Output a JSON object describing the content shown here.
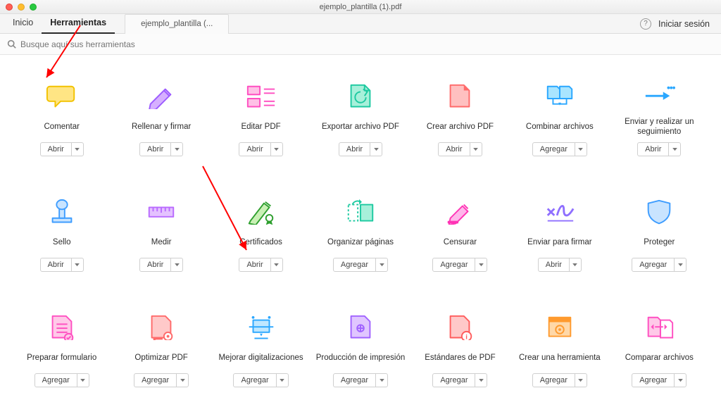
{
  "window": {
    "title": "ejemplo_plantilla (1).pdf"
  },
  "tabs": {
    "home": "Inicio",
    "tools": "Herramientas",
    "doc": "ejemplo_plantilla (..."
  },
  "header": {
    "signin": "Iniciar sesión"
  },
  "search": {
    "placeholder": "Busque aquí sus herramientas"
  },
  "actions": {
    "open": "Abrir",
    "add": "Agregar"
  },
  "tools": [
    {
      "id": "comentar",
      "label": "Comentar",
      "action": "open"
    },
    {
      "id": "rellenar",
      "label": "Rellenar y firmar",
      "action": "open"
    },
    {
      "id": "editar",
      "label": "Editar PDF",
      "action": "open"
    },
    {
      "id": "exportar",
      "label": "Exportar archivo PDF",
      "action": "open"
    },
    {
      "id": "crear",
      "label": "Crear archivo PDF",
      "action": "open"
    },
    {
      "id": "combinar",
      "label": "Combinar archivos",
      "action": "add"
    },
    {
      "id": "enviar-seg",
      "label": "Enviar y realizar un seguimiento",
      "action": "open"
    },
    {
      "id": "sello",
      "label": "Sello",
      "action": "open"
    },
    {
      "id": "medir",
      "label": "Medir",
      "action": "open"
    },
    {
      "id": "certificados",
      "label": "Certificados",
      "action": "open"
    },
    {
      "id": "organizar",
      "label": "Organizar páginas",
      "action": "add"
    },
    {
      "id": "censurar",
      "label": "Censurar",
      "action": "add"
    },
    {
      "id": "enviar-firmar",
      "label": "Enviar para firmar",
      "action": "open"
    },
    {
      "id": "proteger",
      "label": "Proteger",
      "action": "add"
    },
    {
      "id": "preparar-form",
      "label": "Preparar formulario",
      "action": "add"
    },
    {
      "id": "optimizar",
      "label": "Optimizar PDF",
      "action": "add"
    },
    {
      "id": "mejorar-dig",
      "label": "Mejorar digitalizaciones",
      "action": "add"
    },
    {
      "id": "produccion",
      "label": "Producción de impresión",
      "action": "add"
    },
    {
      "id": "estandares",
      "label": "Estándares de PDF",
      "action": "add"
    },
    {
      "id": "crear-herr",
      "label": "Crear una herramienta",
      "action": "add"
    },
    {
      "id": "comparar",
      "label": "Comparar archivos",
      "action": "add"
    }
  ],
  "icons": {
    "comentar": {
      "type": "speech",
      "fill": "#ffe584",
      "stroke": "#f2c200"
    },
    "rellenar": {
      "type": "pencil",
      "fill": "#d6b0ff",
      "stroke": "#9c5bff"
    },
    "editar": {
      "type": "editbox",
      "fill": "#ffc0e6",
      "stroke": "#ff4fc1"
    },
    "exportar": {
      "type": "page-out",
      "fill": "#a7f0da",
      "stroke": "#1cc9a0"
    },
    "crear": {
      "type": "page-corner",
      "fill": "#ffc0c0",
      "stroke": "#ff6a6a"
    },
    "combinar": {
      "type": "combine",
      "fill": "#a9e5ff",
      "stroke": "#2aa7ff"
    },
    "enviar-seg": {
      "type": "arrow-dots",
      "fill": "none",
      "stroke": "#2aa7ff"
    },
    "sello": {
      "type": "stamp",
      "fill": "#c9e4ff",
      "stroke": "#3e9dff"
    },
    "medir": {
      "type": "ruler",
      "fill": "#e4c2ff",
      "stroke": "#b96aff"
    },
    "certificados": {
      "type": "cert",
      "fill": "#c9f0b5",
      "stroke": "#2e9f2e"
    },
    "organizar": {
      "type": "organize",
      "fill": "#a7f0da",
      "stroke": "#1cc9a0"
    },
    "censurar": {
      "type": "marker",
      "fill": "#ffb7eb",
      "stroke": "#ff33b5"
    },
    "enviar-firmar": {
      "type": "sign",
      "fill": "none",
      "stroke": "#8f6fff"
    },
    "proteger": {
      "type": "shield",
      "fill": "#c9e4ff",
      "stroke": "#3e9dff"
    },
    "preparar-form": {
      "type": "checklist",
      "fill": "#ffc9e8",
      "stroke": "#ff4fc1"
    },
    "optimizar": {
      "type": "page-gear",
      "fill": "#ffc9c9",
      "stroke": "#ff6a6a"
    },
    "mejorar-dig": {
      "type": "scan",
      "fill": "#bfe7ff",
      "stroke": "#2aa7ff"
    },
    "produccion": {
      "type": "print",
      "fill": "#e0c6ff",
      "stroke": "#a062ff"
    },
    "estandares": {
      "type": "page-info",
      "fill": "#ffc9c9",
      "stroke": "#ff5c5c"
    },
    "crear-herr": {
      "type": "gear-box",
      "fill": "#ffd8a8",
      "stroke": "#ff9a2e"
    },
    "comparar": {
      "type": "compare",
      "fill": "#ffc9e8",
      "stroke": "#ff4fc1"
    }
  }
}
